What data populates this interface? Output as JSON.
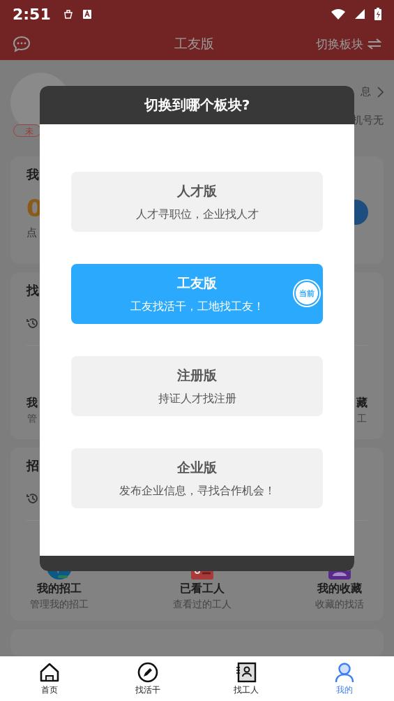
{
  "status_bar": {
    "time": "2:51"
  },
  "app_bar": {
    "title": "工友版",
    "switch_label": "切换板块"
  },
  "profile": {
    "badge": "未",
    "link_fragment": "息",
    "phone_fragment": "机号无"
  },
  "cards": [
    {
      "kind": "stats",
      "title": "我",
      "value": "0",
      "hint": "点"
    },
    {
      "kind": "fragments",
      "title": "找",
      "left_item": {
        "title": "我",
        "subtitle": "管"
      },
      "right_item": {
        "title": "藏",
        "subtitle": "工"
      }
    },
    {
      "kind": "menu",
      "title": "招",
      "items": [
        {
          "title": "我的招工",
          "subtitle": "管理我的招工"
        },
        {
          "title": "已看工人",
          "subtitle": "查看过的工人"
        },
        {
          "title": "我的收藏",
          "subtitle": "收藏的找活"
        }
      ]
    },
    {
      "kind": "empty"
    }
  ],
  "dialog": {
    "title": "切换到哪个板块?",
    "current_badge": "当前",
    "options": [
      {
        "title": "人才版",
        "subtitle": "人才寻职位，企业找人才",
        "selected": false
      },
      {
        "title": "工友版",
        "subtitle": "工友找活干，工地找工友！",
        "selected": true
      },
      {
        "title": "注册版",
        "subtitle": "持证人才找注册",
        "selected": false
      },
      {
        "title": "企业版",
        "subtitle": "发布企业信息，寻找合作机会！",
        "selected": false
      }
    ]
  },
  "tabs": [
    {
      "label": "首页",
      "selected": false
    },
    {
      "label": "找活干",
      "selected": false
    },
    {
      "label": "找工人",
      "selected": false
    },
    {
      "label": "我的",
      "selected": true
    }
  ]
}
